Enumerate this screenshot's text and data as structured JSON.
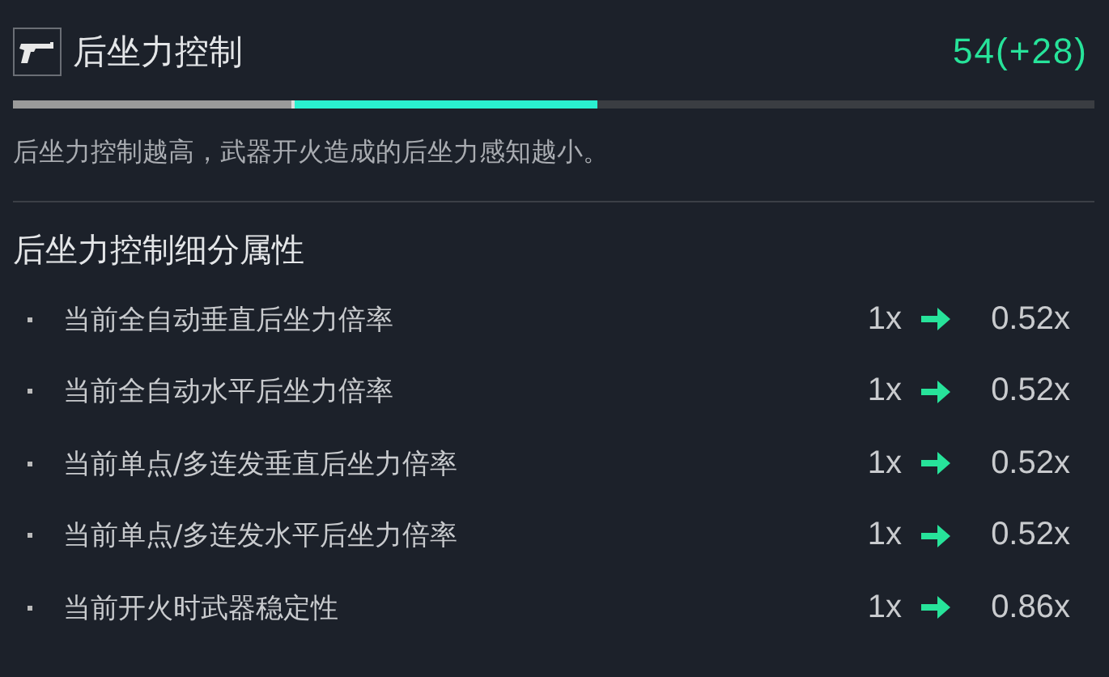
{
  "header": {
    "title": "后坐力控制",
    "value": "54(+28)"
  },
  "bar": {
    "level": 0.54,
    "base": {
      "level": 0.26
    }
  },
  "description": "后坐力控制越高，武器开火造成的后坐力感知越小。",
  "section": {
    "title": "后坐力控制细分属性",
    "rows": [
      {
        "label": "当前全自动垂直后坐力倍率",
        "from": "1x",
        "to": "0.52x"
      },
      {
        "label": "当前全自动水平后坐力倍率",
        "from": "1x",
        "to": "0.52x"
      },
      {
        "label": "当前单点/多连发垂直后坐力倍率",
        "from": "1x",
        "to": "0.52x"
      },
      {
        "label": "当前单点/多连发水平后坐力倍率",
        "from": "1x",
        "to": "0.52x"
      },
      {
        "label": "当前开火时武器稳定性",
        "from": "1x",
        "to": "0.86x"
      }
    ]
  }
}
